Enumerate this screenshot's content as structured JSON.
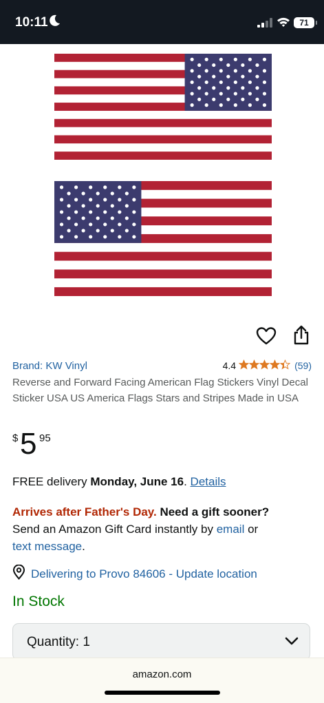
{
  "status_bar": {
    "time": "10:11",
    "battery": "71"
  },
  "product": {
    "brand": "Brand: KW Vinyl",
    "rating": "4.4",
    "rating_value": 4.4,
    "review_count": "(59)",
    "title": "Reverse and Forward Facing American Flag Stickers Vinyl Decal Sticker USA US America Flags Stars and Stripes Made in USA",
    "price": {
      "symbol": "$",
      "whole": "5",
      "fraction": "95"
    }
  },
  "delivery": {
    "prefix": "FREE delivery ",
    "date": "Monday, June 16",
    "suffix": ". ",
    "details_link": "Details"
  },
  "gift": {
    "warning": "Arrives after Father's Day.",
    "question": " Need a gift sooner?",
    "line2_start": "Send an Amazon Gift Card instantly by ",
    "email_link": "email",
    "or": " or",
    "text_link": "text message",
    "end": "."
  },
  "location": {
    "text": "Delivering to Provo 84606 - Update location"
  },
  "stock": {
    "text": "In Stock"
  },
  "quantity": {
    "label": "Quantity:",
    "value": "1"
  },
  "browser": {
    "url": "amazon.com"
  },
  "colors": {
    "link": "#2162a1",
    "stock": "#007600",
    "warning": "#b12704",
    "star": "#de7921",
    "flag_red": "#b22234",
    "flag_blue": "#3c3b6e"
  },
  "icons": [
    "moon-icon",
    "signal-icon",
    "wifi-icon",
    "heart-icon",
    "share-icon",
    "star-icon",
    "location-pin-icon",
    "chevron-down-icon"
  ]
}
